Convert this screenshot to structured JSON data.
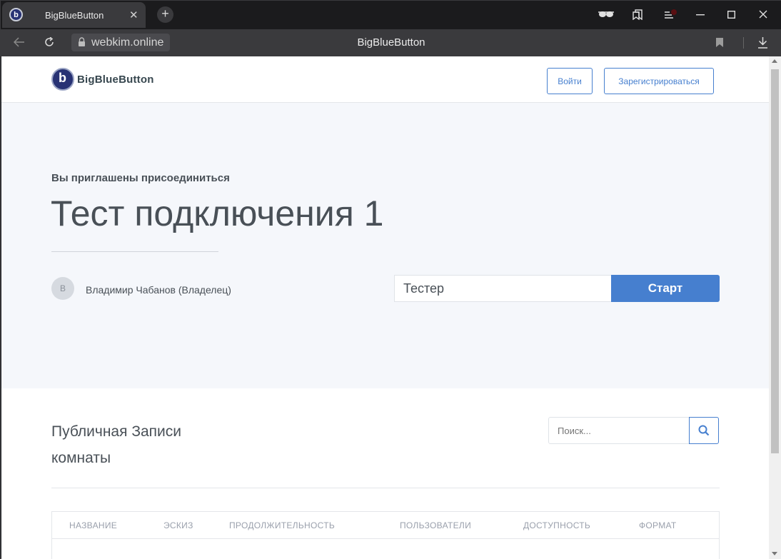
{
  "browser": {
    "tab_title": "BigBlueButton",
    "tab_favicon_letter": "b",
    "url": "webkim.online",
    "page_title": "BigBlueButton",
    "icons": [
      "glasses-icon",
      "bookmarks-icon",
      "menu-icon",
      "minimize-icon",
      "maximize-icon",
      "close-window-icon",
      "back-icon",
      "reload-icon",
      "lock-icon",
      "bookmark-icon",
      "download-icon"
    ]
  },
  "header": {
    "logo_text": "BigBlueButton",
    "logo_letter": "b",
    "login_label": "Войти",
    "signup_label": "Зарегистрироваться"
  },
  "hero": {
    "invite_text": "Вы приглашены присоединиться",
    "room_name": "Тест подключения 1",
    "owner_initial": "В",
    "owner_name": "Владимир Чабанов (Владелец)",
    "name_value": "Тестер",
    "start_label": "Старт"
  },
  "recordings": {
    "title": "Публичная Записи комнаты",
    "search_placeholder": "Поиск...",
    "columns": [
      "НАЗВАНИЕ",
      "ЭСКИЗ",
      "ПРОДОЛЖИТЕЛЬНОСТЬ",
      "ПОЛЬЗОВАТЕЛИ",
      "ДОСТУПНОСТЬ",
      "ФОРМАТ"
    ]
  },
  "colors": {
    "accent": "#467fcf",
    "hero_bg": "#f5f7fb",
    "logo_blue": "#283274"
  }
}
